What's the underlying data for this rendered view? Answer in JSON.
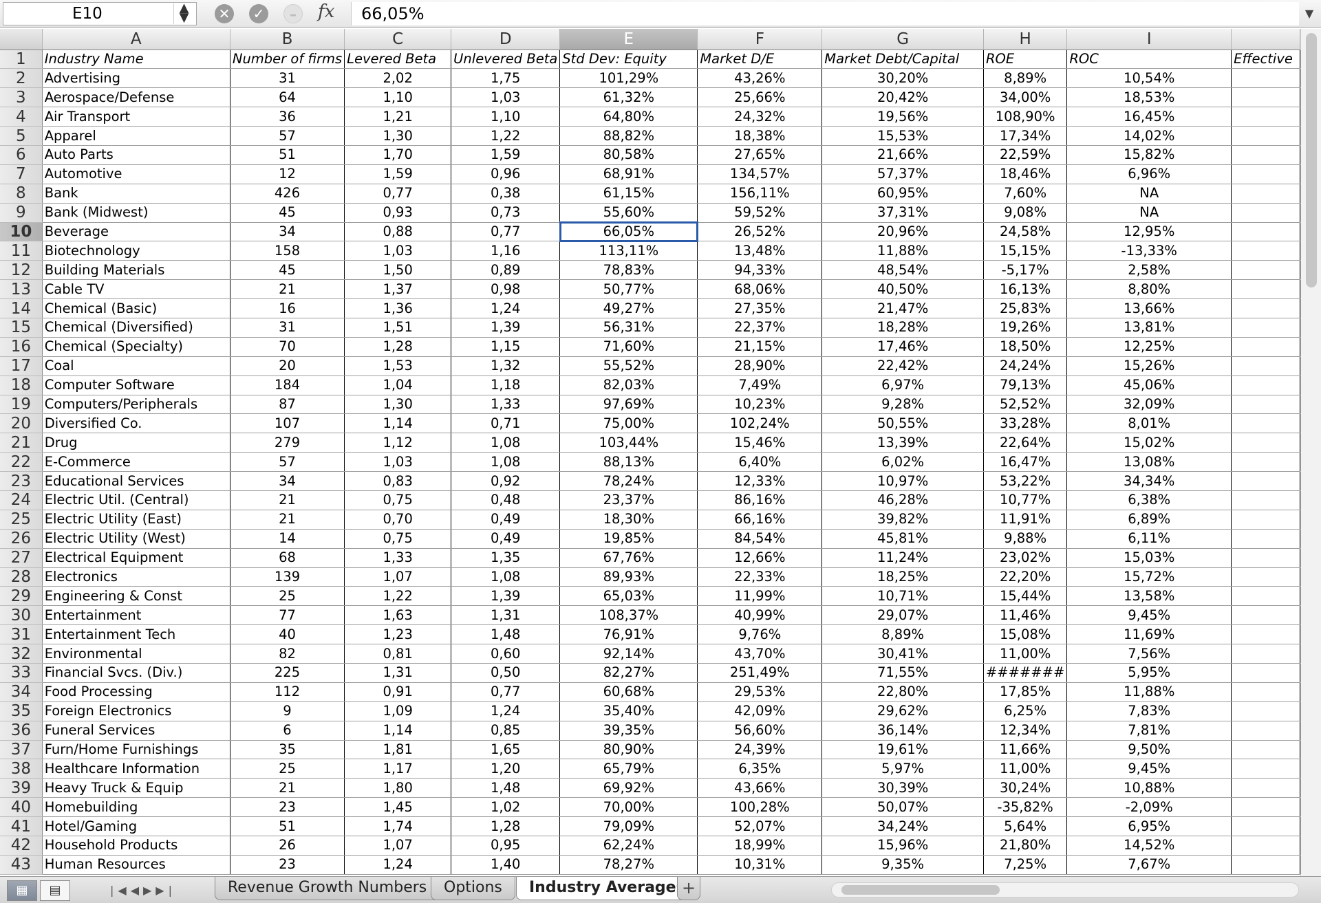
{
  "formula_bar": {
    "cell_ref": "E10",
    "formula": "66,05%",
    "fx_label": "fx"
  },
  "column_letters": [
    "A",
    "B",
    "C",
    "D",
    "E",
    "F",
    "G",
    "H",
    "I"
  ],
  "header_row": [
    "Industry Name",
    "Number of firms",
    "Levered Beta",
    "Unlevered Beta",
    "Std Dev: Equity",
    "Market D/E",
    "Market Debt/Capital",
    "ROE",
    "ROC",
    "Effective"
  ],
  "rows": [
    [
      "Advertising",
      "31",
      "2,02",
      "1,75",
      "101,29%",
      "43,26%",
      "30,20%",
      "8,89%",
      "10,54%"
    ],
    [
      "Aerospace/Defense",
      "64",
      "1,10",
      "1,03",
      "61,32%",
      "25,66%",
      "20,42%",
      "34,00%",
      "18,53%"
    ],
    [
      "Air Transport",
      "36",
      "1,21",
      "1,10",
      "64,80%",
      "24,32%",
      "19,56%",
      "108,90%",
      "16,45%"
    ],
    [
      "Apparel",
      "57",
      "1,30",
      "1,22",
      "88,82%",
      "18,38%",
      "15,53%",
      "17,34%",
      "14,02%"
    ],
    [
      "Auto Parts",
      "51",
      "1,70",
      "1,59",
      "80,58%",
      "27,65%",
      "21,66%",
      "22,59%",
      "15,82%"
    ],
    [
      "Automotive",
      "12",
      "1,59",
      "0,96",
      "68,91%",
      "134,57%",
      "57,37%",
      "18,46%",
      "6,96%"
    ],
    [
      "Bank",
      "426",
      "0,77",
      "0,38",
      "61,15%",
      "156,11%",
      "60,95%",
      "7,60%",
      "NA"
    ],
    [
      "Bank (Midwest)",
      "45",
      "0,93",
      "0,73",
      "55,60%",
      "59,52%",
      "37,31%",
      "9,08%",
      "NA"
    ],
    [
      "Beverage",
      "34",
      "0,88",
      "0,77",
      "66,05%",
      "26,52%",
      "20,96%",
      "24,58%",
      "12,95%"
    ],
    [
      "Biotechnology",
      "158",
      "1,03",
      "1,16",
      "113,11%",
      "13,48%",
      "11,88%",
      "15,15%",
      "-13,33%"
    ],
    [
      "Building Materials",
      "45",
      "1,50",
      "0,89",
      "78,83%",
      "94,33%",
      "48,54%",
      "-5,17%",
      "2,58%"
    ],
    [
      "Cable TV",
      "21",
      "1,37",
      "0,98",
      "50,77%",
      "68,06%",
      "40,50%",
      "16,13%",
      "8,80%"
    ],
    [
      "Chemical (Basic)",
      "16",
      "1,36",
      "1,24",
      "49,27%",
      "27,35%",
      "21,47%",
      "25,83%",
      "13,66%"
    ],
    [
      "Chemical (Diversified)",
      "31",
      "1,51",
      "1,39",
      "56,31%",
      "22,37%",
      "18,28%",
      "19,26%",
      "13,81%"
    ],
    [
      "Chemical (Specialty)",
      "70",
      "1,28",
      "1,15",
      "71,60%",
      "21,15%",
      "17,46%",
      "18,50%",
      "12,25%"
    ],
    [
      "Coal",
      "20",
      "1,53",
      "1,32",
      "55,52%",
      "28,90%",
      "22,42%",
      "24,24%",
      "15,26%"
    ],
    [
      "Computer Software",
      "184",
      "1,04",
      "1,18",
      "82,03%",
      "7,49%",
      "6,97%",
      "79,13%",
      "45,06%"
    ],
    [
      "Computers/Peripherals",
      "87",
      "1,30",
      "1,33",
      "97,69%",
      "10,23%",
      "9,28%",
      "52,52%",
      "32,09%"
    ],
    [
      "Diversified Co.",
      "107",
      "1,14",
      "0,71",
      "75,00%",
      "102,24%",
      "50,55%",
      "33,28%",
      "8,01%"
    ],
    [
      "Drug",
      "279",
      "1,12",
      "1,08",
      "103,44%",
      "15,46%",
      "13,39%",
      "22,64%",
      "15,02%"
    ],
    [
      "E-Commerce",
      "57",
      "1,03",
      "1,08",
      "88,13%",
      "6,40%",
      "6,02%",
      "16,47%",
      "13,08%"
    ],
    [
      "Educational Services",
      "34",
      "0,83",
      "0,92",
      "78,24%",
      "12,33%",
      "10,97%",
      "53,22%",
      "34,34%"
    ],
    [
      "Electric Util. (Central)",
      "21",
      "0,75",
      "0,48",
      "23,37%",
      "86,16%",
      "46,28%",
      "10,77%",
      "6,38%"
    ],
    [
      "Electric Utility (East)",
      "21",
      "0,70",
      "0,49",
      "18,30%",
      "66,16%",
      "39,82%",
      "11,91%",
      "6,89%"
    ],
    [
      "Electric Utility (West)",
      "14",
      "0,75",
      "0,49",
      "19,85%",
      "84,54%",
      "45,81%",
      "9,88%",
      "6,11%"
    ],
    [
      "Electrical Equipment",
      "68",
      "1,33",
      "1,35",
      "67,76%",
      "12,66%",
      "11,24%",
      "23,02%",
      "15,03%"
    ],
    [
      "Electronics",
      "139",
      "1,07",
      "1,08",
      "89,93%",
      "22,33%",
      "18,25%",
      "22,20%",
      "15,72%"
    ],
    [
      "Engineering & Const",
      "25",
      "1,22",
      "1,39",
      "65,03%",
      "11,99%",
      "10,71%",
      "15,44%",
      "13,58%"
    ],
    [
      "Entertainment",
      "77",
      "1,63",
      "1,31",
      "108,37%",
      "40,99%",
      "29,07%",
      "11,46%",
      "9,45%"
    ],
    [
      "Entertainment Tech",
      "40",
      "1,23",
      "1,48",
      "76,91%",
      "9,76%",
      "8,89%",
      "15,08%",
      "11,69%"
    ],
    [
      "Environmental",
      "82",
      "0,81",
      "0,60",
      "92,14%",
      "43,70%",
      "30,41%",
      "11,00%",
      "7,56%"
    ],
    [
      "Financial Svcs. (Div.)",
      "225",
      "1,31",
      "0,50",
      "82,27%",
      "251,49%",
      "71,55%",
      "#######",
      "5,95%"
    ],
    [
      "Food Processing",
      "112",
      "0,91",
      "0,77",
      "60,68%",
      "29,53%",
      "22,80%",
      "17,85%",
      "11,88%"
    ],
    [
      "Foreign Electronics",
      "9",
      "1,09",
      "1,24",
      "35,40%",
      "42,09%",
      "29,62%",
      "6,25%",
      "7,83%"
    ],
    [
      "Funeral Services",
      "6",
      "1,14",
      "0,85",
      "39,35%",
      "56,60%",
      "36,14%",
      "12,34%",
      "7,81%"
    ],
    [
      "Furn/Home Furnishings",
      "35",
      "1,81",
      "1,65",
      "80,90%",
      "24,39%",
      "19,61%",
      "11,66%",
      "9,50%"
    ],
    [
      "Healthcare Information",
      "25",
      "1,17",
      "1,20",
      "65,79%",
      "6,35%",
      "5,97%",
      "11,00%",
      "9,45%"
    ],
    [
      "Heavy Truck & Equip",
      "21",
      "1,80",
      "1,48",
      "69,92%",
      "43,66%",
      "30,39%",
      "30,24%",
      "10,88%"
    ],
    [
      "Homebuilding",
      "23",
      "1,45",
      "1,02",
      "70,00%",
      "100,28%",
      "50,07%",
      "-35,82%",
      "-2,09%"
    ],
    [
      "Hotel/Gaming",
      "51",
      "1,74",
      "1,28",
      "79,09%",
      "52,07%",
      "34,24%",
      "5,64%",
      "6,95%"
    ],
    [
      "Household Products",
      "26",
      "1,07",
      "0,95",
      "62,24%",
      "18,99%",
      "15,96%",
      "21,80%",
      "14,52%"
    ],
    [
      "Human Resources",
      "23",
      "1,24",
      "1,40",
      "78,27%",
      "10,31%",
      "9,35%",
      "7,25%",
      "7,67%"
    ]
  ],
  "active_cell": {
    "row": 10,
    "col": "E"
  },
  "sheet_tabs": [
    "Revenue Growth Numbers",
    "Options",
    "Industry Averages"
  ],
  "active_tab": "Industry Averages",
  "add_tab_label": "+",
  "colors": {
    "selection_border": "#2a5aa8",
    "header_bg": "#dcdcdc"
  }
}
